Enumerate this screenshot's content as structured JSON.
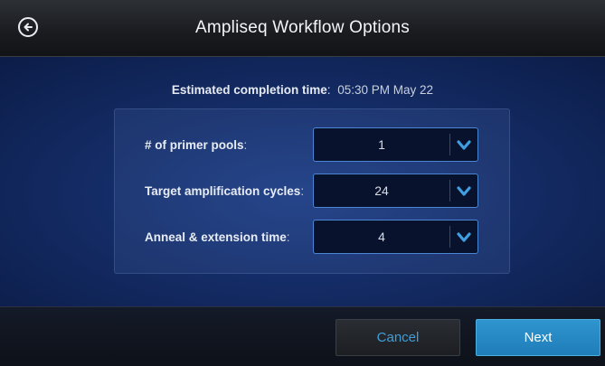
{
  "header": {
    "title": "Ampliseq Workflow Options",
    "back_icon": "back-arrow-circle-icon"
  },
  "completion": {
    "label": "Estimated completion time",
    "colon": ":",
    "value": "05:30 PM May 22"
  },
  "options": [
    {
      "label": "# of primer pools",
      "value": "1",
      "icon": "chevron-down-icon"
    },
    {
      "label": "Target amplification cycles",
      "value": "24",
      "icon": "chevron-down-icon"
    },
    {
      "label": "Anneal & extension time",
      "value": "4",
      "icon": "chevron-down-icon"
    }
  ],
  "footer": {
    "cancel_label": "Cancel",
    "next_label": "Next"
  },
  "colors": {
    "accent": "#3f9fd9",
    "next_button": "#2688c3",
    "background": "#142c66"
  }
}
